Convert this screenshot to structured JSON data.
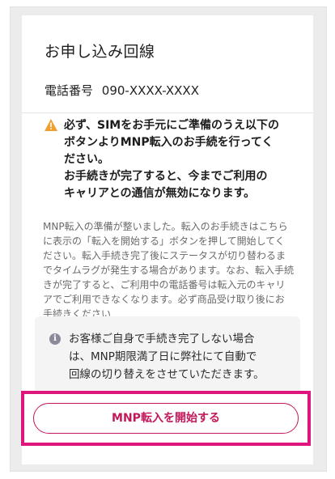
{
  "section": {
    "title": "お申し込み回線",
    "phone_label": "電話番号",
    "phone_number": "090-XXXX-XXXX"
  },
  "warning": {
    "icon": "warning-triangle-icon",
    "color": "#f0a030",
    "lines": [
      "必ず、SIMをお手元にご準備のうえ以下の",
      "ボタンよりMNP転入のお手続を行ってく",
      "ださい。",
      "お手続きが完了すると、今までご利用の",
      "キャリアとの通信が無効になります。"
    ]
  },
  "description": {
    "lines": [
      "MNP転入の準備が整いました。転入のお手続きはこちら",
      "に表示の「転入を開始する」ボタンを押して開始してく",
      "ださい。転入手続き完了後にステータスが切り替わるま",
      "でタイムラグが発生する場合があります。なお、転入手続",
      "きが完了すると、ご利用中の電話番号は転入元のキャリ",
      "アでご利用できなくなります。必ず商品受け取り後にお",
      "手続きください"
    ]
  },
  "info": {
    "icon": "info-icon",
    "lines": [
      "お客様ご自身で手続き完了しない場合",
      "は、MNP期限満了日に弊社にて自動で",
      "回線の切り替えをさせていただきます。"
    ]
  },
  "action": {
    "start_label": "MNP転入を開始する",
    "accent_color": "#c2185b",
    "highlight_color": "#e0147f"
  }
}
